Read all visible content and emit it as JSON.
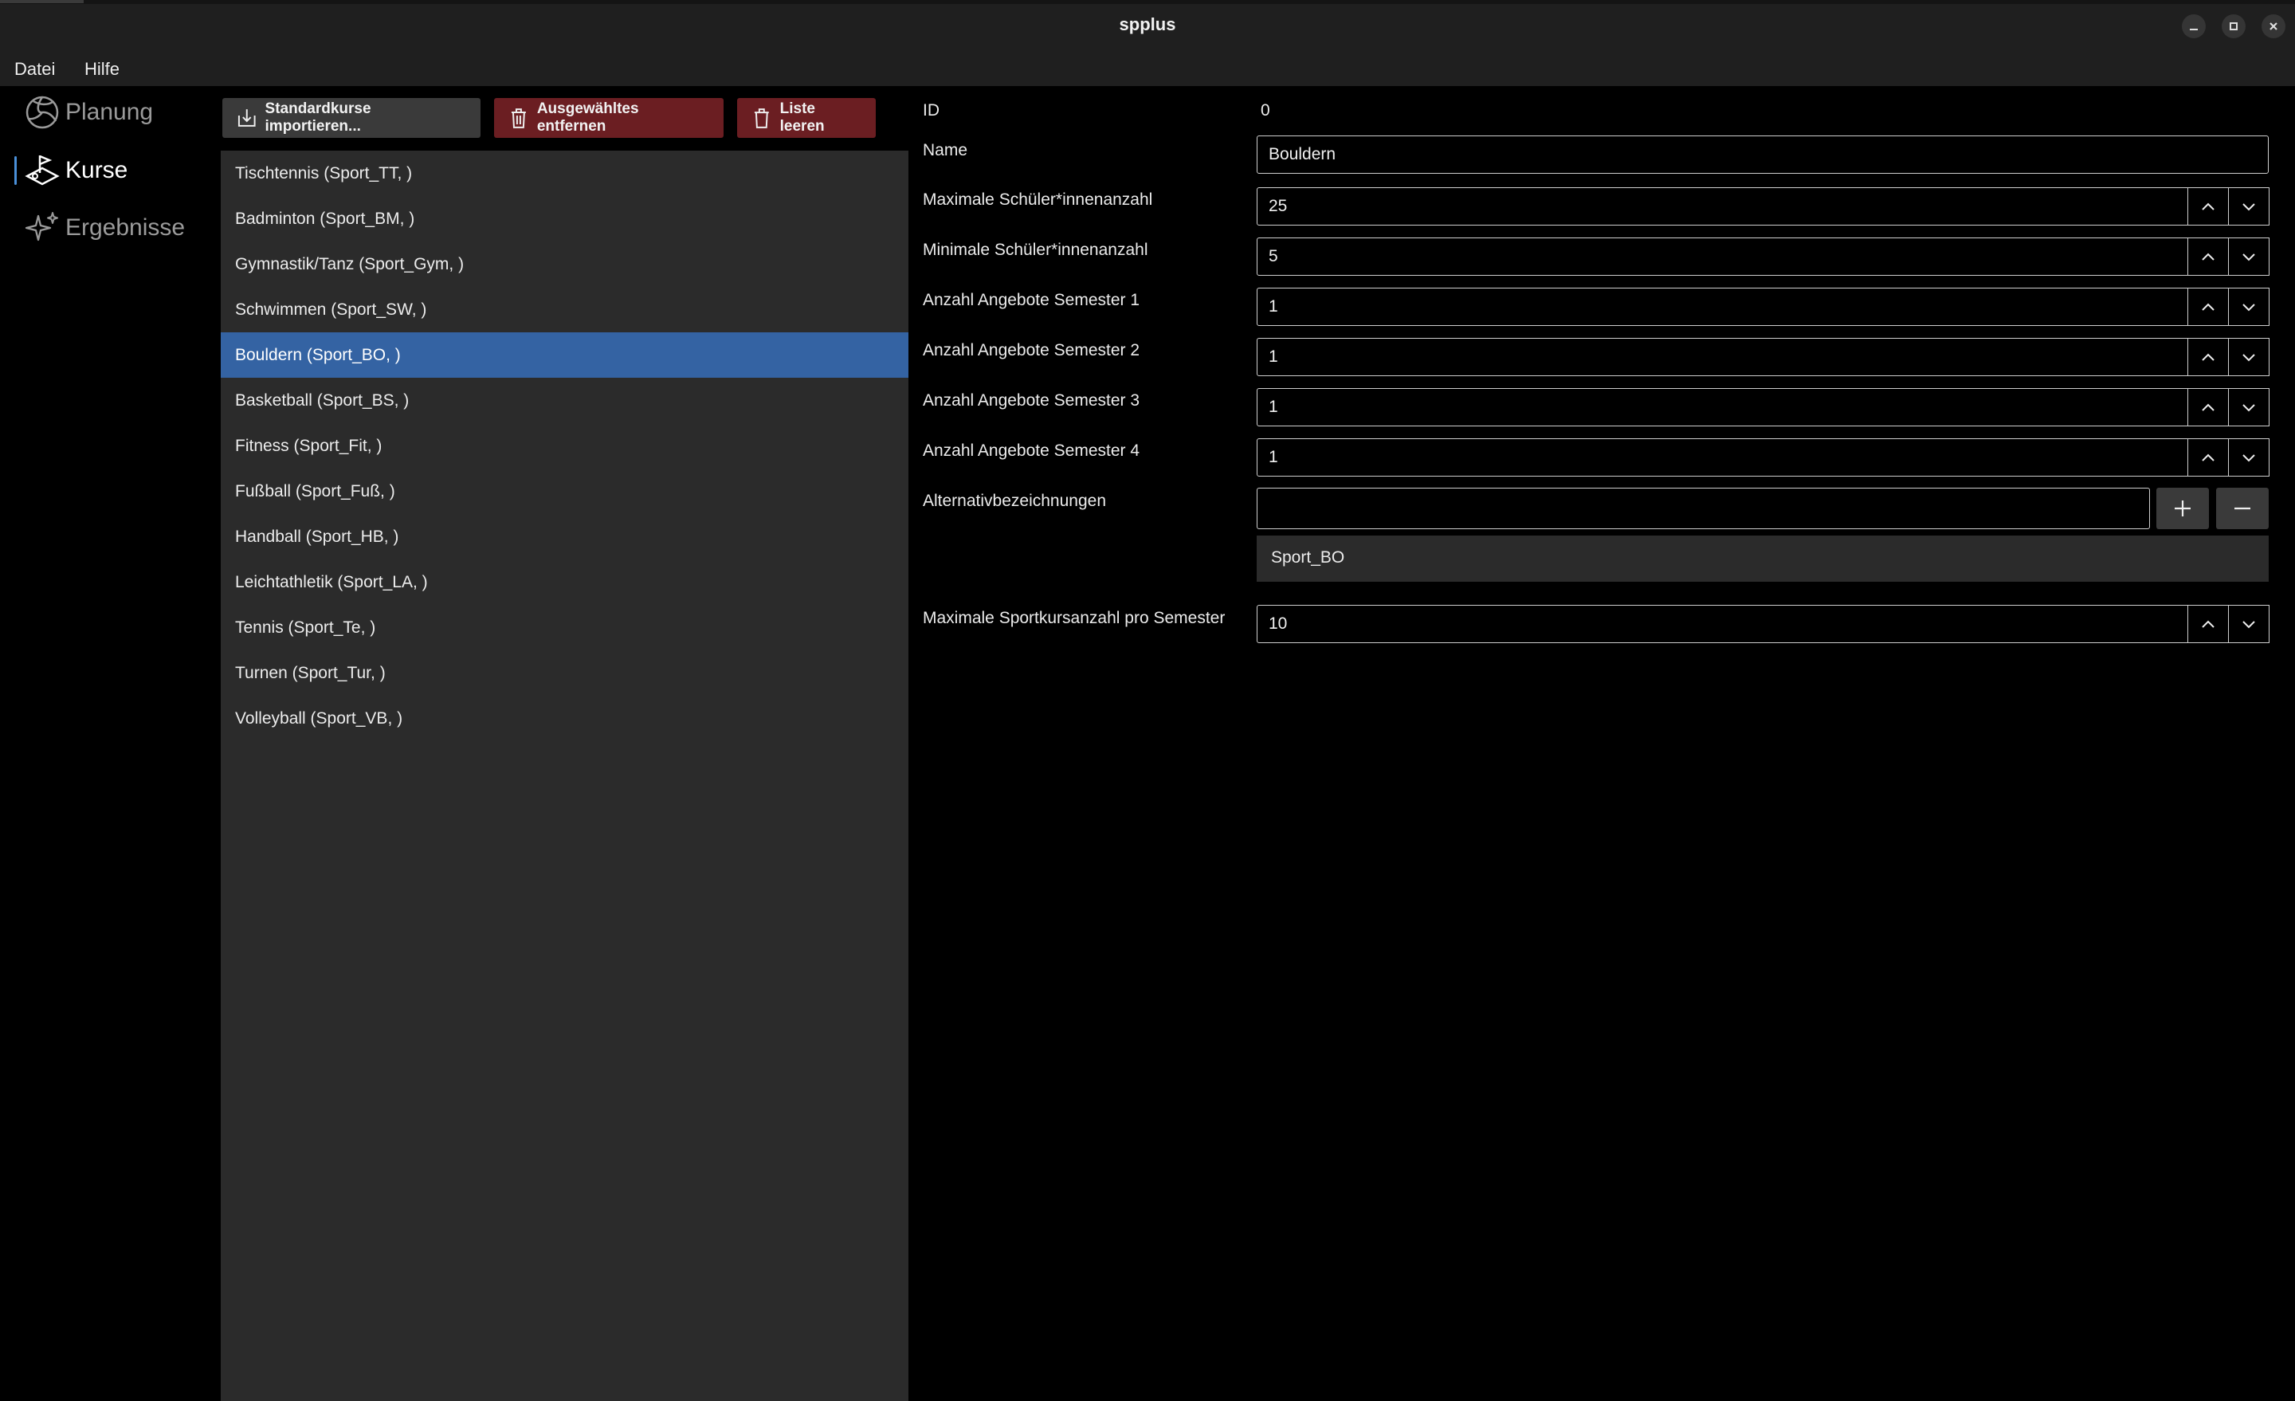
{
  "window": {
    "title": "spplus"
  },
  "menu": {
    "items": [
      "Datei",
      "Hilfe"
    ]
  },
  "nav": {
    "items": [
      {
        "label": "Planung",
        "icon": "volleyball-icon",
        "active": false
      },
      {
        "label": "Kurse",
        "icon": "sport-field-icon",
        "active": true
      },
      {
        "label": "Ergebnisse",
        "icon": "sparkle-icon",
        "active": false
      }
    ]
  },
  "toolbar": {
    "import_label": "Standardkurse importieren...",
    "remove_label": "Ausgewähltes entfernen",
    "clear_label": "Liste leeren"
  },
  "courses": {
    "selected_index": 4,
    "items": [
      "Tischtennis (Sport_TT, )",
      "Badminton (Sport_BM, )",
      "Gymnastik/Tanz (Sport_Gym, )",
      "Schwimmen (Sport_SW, )",
      "Bouldern (Sport_BO, )",
      "Basketball (Sport_BS, )",
      "Fitness (Sport_Fit, )",
      "Fußball (Sport_Fuß, )",
      "Handball (Sport_HB, )",
      "Leichtathletik (Sport_LA, )",
      "Tennis (Sport_Te, )",
      "Turnen (Sport_Tur, )",
      "Volleyball (Sport_VB, )"
    ]
  },
  "form": {
    "id_label": "ID",
    "id_value": "0",
    "name_label": "Name",
    "name_value": "Bouldern",
    "max_students_label": "Maximale Schüler*innenanzahl",
    "max_students_value": "25",
    "min_students_label": "Minimale Schüler*innenanzahl",
    "min_students_value": "5",
    "sem1_label": "Anzahl Angebote Semester 1",
    "sem1_value": "1",
    "sem2_label": "Anzahl Angebote Semester 2",
    "sem2_value": "1",
    "sem3_label": "Anzahl Angebote Semester 3",
    "sem3_value": "1",
    "sem4_label": "Anzahl Angebote Semester 4",
    "sem4_value": "1",
    "alt_label": "Alternativbezeichnungen",
    "alt_input_value": "",
    "alt_items": [
      "Sport_BO"
    ],
    "max_per_sem_label": "Maximale Sportkursanzahl pro Semester",
    "max_per_sem_value": "10"
  },
  "colors": {
    "accent": "#3463a3",
    "danger": "#6b1e22",
    "panel": "#2b2b2b",
    "background": "#000000"
  }
}
